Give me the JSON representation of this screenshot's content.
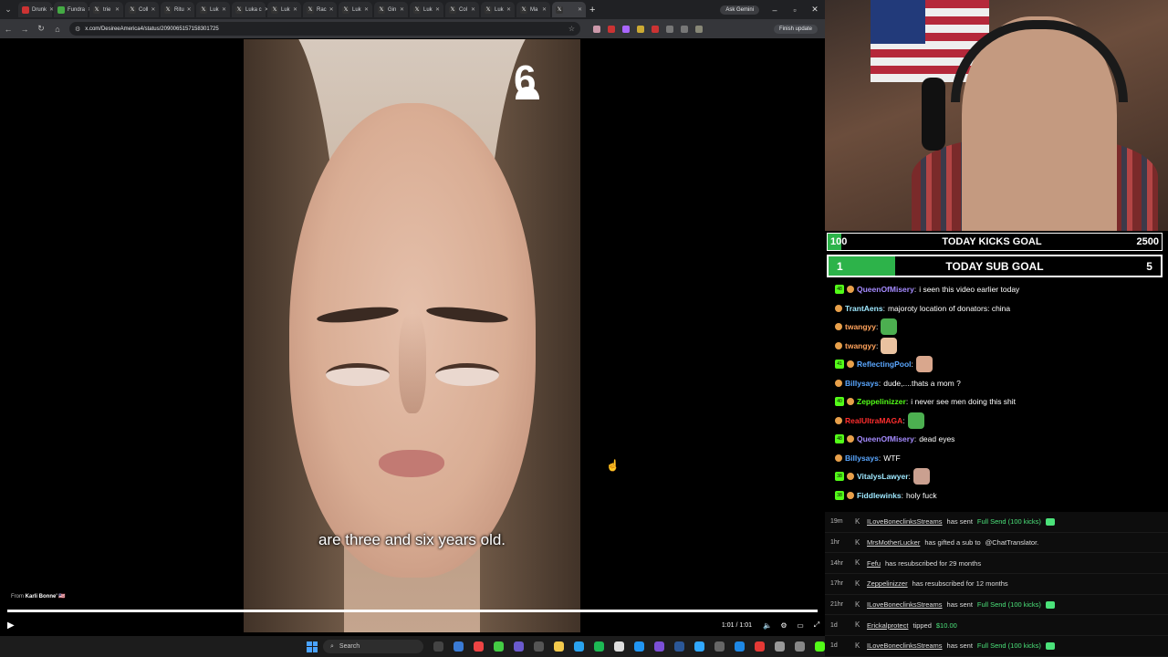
{
  "browser": {
    "tabs": [
      {
        "label": "Drunk",
        "active": false
      },
      {
        "label": "Fundra",
        "active": false
      },
      {
        "label": "trie",
        "active": false
      },
      {
        "label": "Coll",
        "active": false
      },
      {
        "label": "Ritu",
        "active": false
      },
      {
        "label": "Luk",
        "active": false
      },
      {
        "label": "Luka c",
        "active": false
      },
      {
        "label": "Luk",
        "active": false
      },
      {
        "label": "Rac",
        "active": false
      },
      {
        "label": "Luk",
        "active": false
      },
      {
        "label": "Gin",
        "active": false
      },
      {
        "label": "Luk",
        "active": false
      },
      {
        "label": "Col",
        "active": false
      },
      {
        "label": "Luk",
        "active": false
      },
      {
        "label": "Ma",
        "active": false
      },
      {
        "label": "",
        "active": true
      }
    ],
    "new_tab": "+",
    "ask_gemini": "Ask Gemini",
    "url": "x.com/DesireeAmerica4/status/2090065157158301725",
    "finish_update": "Finish update"
  },
  "video": {
    "subtitle": "are three and six years old.",
    "network_logo": "6",
    "from_label": "From",
    "from_name": "Karli Bonne' 🇺🇸",
    "progress": 1.0,
    "timecode": "1:01 / 1:01"
  },
  "taskbar": {
    "search_placeholder": "Search"
  },
  "goals": {
    "kicks": {
      "current": "100",
      "label": "TODAY KICKS GOAL",
      "target": "2500",
      "progress": 0.04
    },
    "subs": {
      "current": "1",
      "label": "TODAY SUB GOAL",
      "target": "5",
      "progress": 0.2
    }
  },
  "chat": [
    {
      "user": "QueenOfMisery",
      "color": "#a58bff",
      "badge": "48",
      "text": "i seen this video earlier today"
    },
    {
      "user": "TrantAens",
      "color": "#9ee8ff",
      "badge": "",
      "text": "majoroty location of donators: china"
    },
    {
      "user": "twangyy",
      "color": "#ffa35c",
      "badge": "",
      "text": "",
      "emote": "#4caf50"
    },
    {
      "user": "twangyy",
      "color": "#ffa35c",
      "badge": "",
      "text": "",
      "emote": "#e9c2a0"
    },
    {
      "user": "ReflectingPool",
      "color": "#5aa7ff",
      "badge": "41",
      "text": "",
      "emote": "#d9a78d"
    },
    {
      "user": "Billysays",
      "color": "#5aa7ff",
      "badge": "",
      "text": "dude,....thats a mom ?"
    },
    {
      "user": "Zeppelinizzer",
      "color": "#53fc18",
      "badge": "40",
      "text": "i never see men doing this shit"
    },
    {
      "user": "RealUltraMAGA",
      "color": "#ff2d2d",
      "badge": "",
      "text": "",
      "emote": "#4caf50"
    },
    {
      "user": "QueenOfMisery",
      "color": "#a58bff",
      "badge": "48",
      "text": "dead eyes"
    },
    {
      "user": "Billysays",
      "color": "#5aa7ff",
      "badge": "",
      "text": "WTF"
    },
    {
      "user": "VitalysLawyer",
      "color": "#9ee8ff",
      "badge": "38",
      "text": "",
      "emote": "#caa090"
    },
    {
      "user": "Fiddlewinks",
      "color": "#9ee8ff",
      "badge": "38",
      "text": "holy fuck"
    }
  ],
  "events": [
    {
      "time": "19m",
      "user": "ILoveBoneclinksStreams",
      "text": "has sent",
      "highlight": "Full Send (100 kicks)",
      "coin": true
    },
    {
      "time": "1hr",
      "user": "MrsMotherLucker",
      "text": "has gifted a sub to",
      "highlight": "@ChatTranslator.",
      "coin": false
    },
    {
      "time": "14hr",
      "user": "Fefu",
      "text": "has resubscribed for 29 months",
      "highlight": "",
      "coin": false
    },
    {
      "time": "17hr",
      "user": "Zeppelinizzer",
      "text": "has resubscribed for 12 months",
      "highlight": "",
      "coin": false
    },
    {
      "time": "21hr",
      "user": "ILoveBoneclinksStreams",
      "text": "has sent",
      "highlight": "Full Send (100 kicks)",
      "coin": true
    },
    {
      "time": "1d",
      "user": "Erickalprotect",
      "text": "tipped",
      "highlight": "$10.00",
      "coin": false
    },
    {
      "time": "1d",
      "user": "ILoveBoneclinksStreams",
      "text": "has sent",
      "highlight": "Full Send (100 kicks)",
      "coin": true
    }
  ],
  "colors": {
    "accent_green": "#53fc18",
    "goal_fill": "#2db34a"
  }
}
